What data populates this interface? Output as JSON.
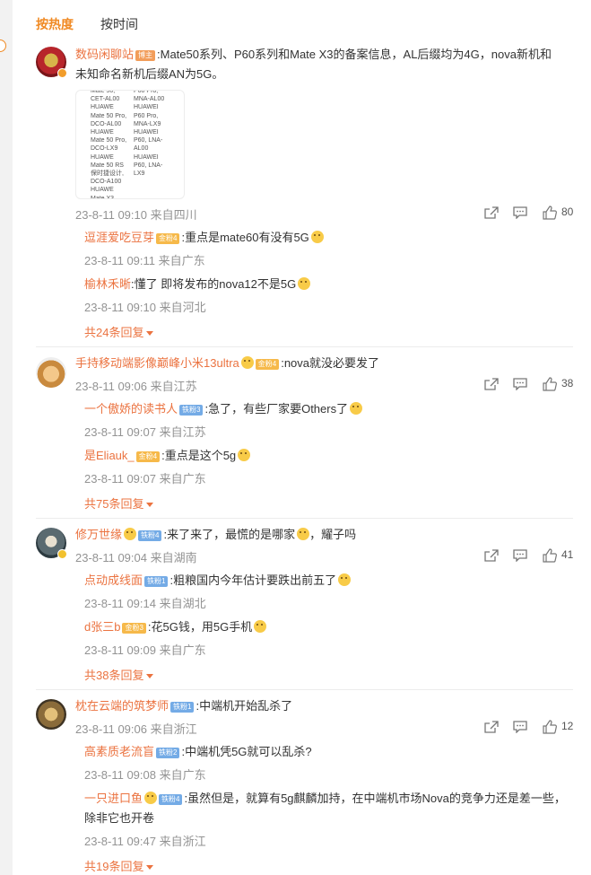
{
  "tabs": {
    "hot": "按热度",
    "time": "按时间"
  },
  "comments": [
    {
      "user": "数码闲聊站",
      "badge": "博主",
      "text": ":Mate50系列、P60系列和Mate X3的备案信息，AL后缀均为4G，nova新机和",
      "text2": "未知命名新机后缀AN为5G。",
      "thumb_col1": "Mate 50,\nCET-AL00\nHUAWE\nMate 50 Pro,\nDCO-AL00\nHUAWE\nMate 50 Pro,\nDCO-LX9\nHUAWE\nMate 50 RS\n保时捷设计,\nDCO-A100\nHUAWE\nMate X3",
      "thumb_col2": "P60 Pro,\nMNA-AL00\nHUAWEI\nP60 Pro,\nMNA-LX9\nHUAWEI\nP60, LNA-\nAL00\nHUAWEI\nP60, LNA-\nLX9",
      "time": "23-8-11 09:10 来自四川",
      "likes": "80",
      "replies": [
        {
          "user": "逗涯爱吃豆芽",
          "badge": "金粉4",
          "text": ":重点是mate60有没有5G",
          "time": "23-8-11 09:11 来自广东"
        },
        {
          "user": "榆林禾晰",
          "badge": "",
          "text": ":懂了 即将发布的nova12不是5G",
          "time": "23-8-11 09:10 来自河北"
        }
      ],
      "more": "共24条回复"
    },
    {
      "user": "手持移动端影像巅峰小米13ultra",
      "badge": "金粉4",
      "text": ":nova就没必要发了",
      "time": "23-8-11 09:06 来自江苏",
      "likes": "38",
      "replies": [
        {
          "user": "一个傲娇的读书人",
          "badge": "铁粉3",
          "text": ":急了，有些厂家要Others了",
          "time": "23-8-11 09:07 来自江苏"
        },
        {
          "user": "是Eliauk_",
          "badge": "金粉4",
          "text": ":重点是这个5g",
          "time": "23-8-11 09:07 来自广东"
        }
      ],
      "more": "共75条回复"
    },
    {
      "user": "修万世缘",
      "badge": "铁粉4",
      "text": ":来了来了，最慌的是哪家",
      "text_tail": "，耀子吗",
      "time": "23-8-11 09:04 来自湖南",
      "likes": "41",
      "replies": [
        {
          "user": "点动成线面",
          "badge": "铁粉1",
          "text": ":粗粮国内今年估计要跌出前五了",
          "time": "23-8-11 09:14 来自湖北"
        },
        {
          "user": "d张三b",
          "badge": "金粉3",
          "text": ":花5G钱，用5G手机",
          "time": "23-8-11 09:09 来自广东"
        }
      ],
      "more": "共38条回复"
    },
    {
      "user": "枕在云端的筑梦师",
      "badge": "铁粉1",
      "text": ":中端机开始乱杀了",
      "time": "23-8-11 09:06 来自浙江",
      "likes": "12",
      "replies": [
        {
          "user": "高素质老流盲",
          "badge": "铁粉2",
          "text": ":中端机凭5G就可以乱杀?",
          "time": "23-8-11 09:08 来自广东"
        },
        {
          "user": "一只进口鱼",
          "badge": "铁粉4",
          "text": ":虽然但是，就算有5g麒麟加持，在中端机市场Nova的竞争力还是差一些，",
          "text2": "除非它也开卷",
          "time": "23-8-11 09:47 来自浙江"
        }
      ],
      "more": "共19条回复"
    }
  ]
}
